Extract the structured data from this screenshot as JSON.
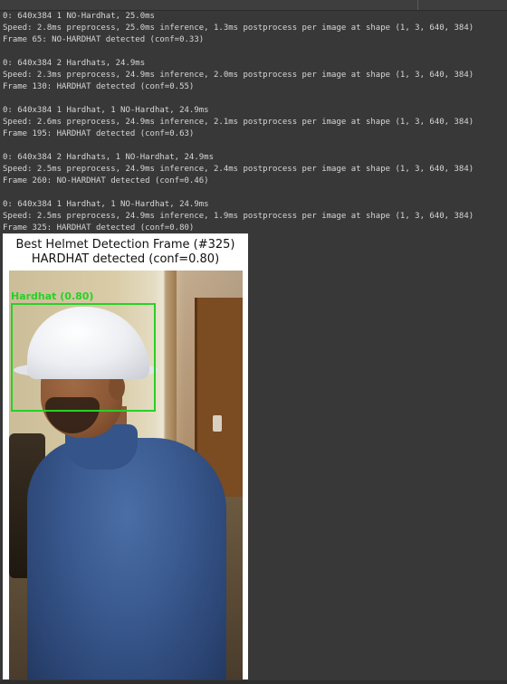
{
  "console": {
    "blocks": [
      [
        "0: 640x384 1 NO-Hardhat, 25.0ms",
        "Speed: 2.8ms preprocess, 25.0ms inference, 1.3ms postprocess per image at shape (1, 3, 640, 384)",
        "Frame 65: NO-HARDHAT detected (conf=0.33)"
      ],
      [
        "0: 640x384 2 Hardhats, 24.9ms",
        "Speed: 2.3ms preprocess, 24.9ms inference, 2.0ms postprocess per image at shape (1, 3, 640, 384)",
        "Frame 130: HARDHAT detected (conf=0.55)"
      ],
      [
        "0: 640x384 1 Hardhat, 1 NO-Hardhat, 24.9ms",
        "Speed: 2.6ms preprocess, 24.9ms inference, 2.1ms postprocess per image at shape (1, 3, 640, 384)",
        "Frame 195: HARDHAT detected (conf=0.63)"
      ],
      [
        "0: 640x384 2 Hardhats, 1 NO-Hardhat, 24.9ms",
        "Speed: 2.5ms preprocess, 24.9ms inference, 2.4ms postprocess per image at shape (1, 3, 640, 384)",
        "Frame 260: NO-HARDHAT detected (conf=0.46)"
      ],
      [
        "0: 640x384 1 Hardhat, 1 NO-Hardhat, 24.9ms",
        "Speed: 2.5ms preprocess, 24.9ms inference, 1.9ms postprocess per image at shape (1, 3, 640, 384)",
        "Frame 325: HARDHAT detected (conf=0.80)"
      ]
    ]
  },
  "figure": {
    "title_line1": "Best Helmet Detection Frame (#325)",
    "title_line2": "HARDHAT detected (conf=0.80)",
    "bbox_label": "Hardhat (0.80)",
    "bbox_color": "#27d127"
  },
  "colors": {
    "background": "#383838",
    "console_text": "#d6d6d6"
  }
}
